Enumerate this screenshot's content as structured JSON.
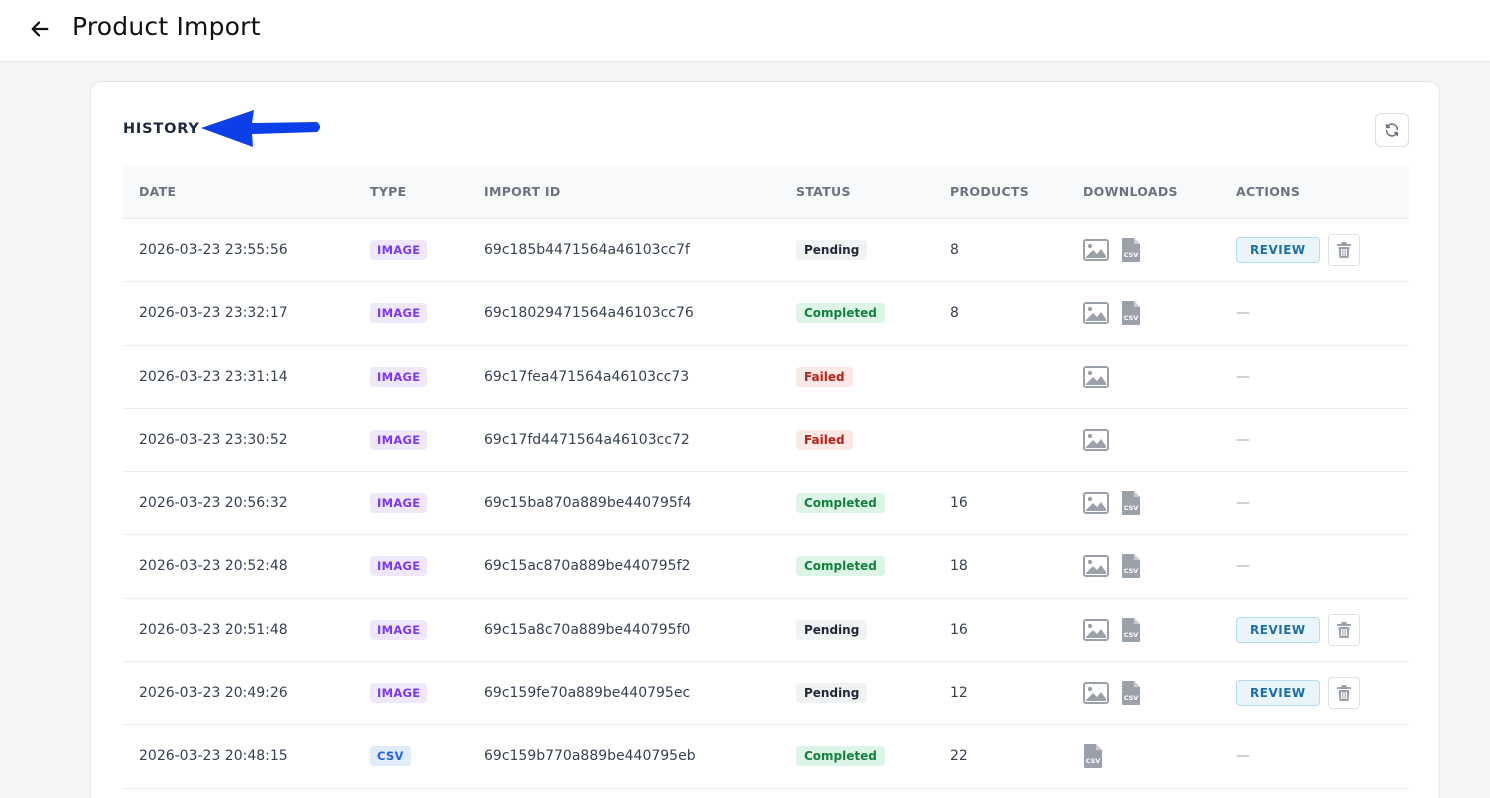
{
  "header": {
    "title": "Product Import"
  },
  "history": {
    "title": "HISTORY"
  },
  "table": {
    "columns": [
      "DATE",
      "TYPE",
      "IMPORT ID",
      "STATUS",
      "PRODUCTS",
      "DOWNLOADS",
      "ACTIONS"
    ],
    "rows": [
      {
        "date": "2026-03-23 23:55:56",
        "type": "IMAGE",
        "import_id": "69c185b4471564a46103cc7f",
        "status": "Pending",
        "products": "8",
        "downloads": [
          "image",
          "csv"
        ],
        "actions": "review"
      },
      {
        "date": "2026-03-23 23:32:17",
        "type": "IMAGE",
        "import_id": "69c18029471564a46103cc76",
        "status": "Completed",
        "products": "8",
        "downloads": [
          "image",
          "csv"
        ],
        "actions": "—"
      },
      {
        "date": "2026-03-23 23:31:14",
        "type": "IMAGE",
        "import_id": "69c17fea471564a46103cc73",
        "status": "Failed",
        "products": "",
        "downloads": [
          "image"
        ],
        "actions": "—"
      },
      {
        "date": "2026-03-23 23:30:52",
        "type": "IMAGE",
        "import_id": "69c17fd4471564a46103cc72",
        "status": "Failed",
        "products": "",
        "downloads": [
          "image"
        ],
        "actions": "—"
      },
      {
        "date": "2026-03-23 20:56:32",
        "type": "IMAGE",
        "import_id": "69c15ba870a889be440795f4",
        "status": "Completed",
        "products": "16",
        "downloads": [
          "image",
          "csv"
        ],
        "actions": "—"
      },
      {
        "date": "2026-03-23 20:52:48",
        "type": "IMAGE",
        "import_id": "69c15ac870a889be440795f2",
        "status": "Completed",
        "products": "18",
        "downloads": [
          "image",
          "csv"
        ],
        "actions": "—"
      },
      {
        "date": "2026-03-23 20:51:48",
        "type": "IMAGE",
        "import_id": "69c15a8c70a889be440795f0",
        "status": "Pending",
        "products": "16",
        "downloads": [
          "image",
          "csv"
        ],
        "actions": "review"
      },
      {
        "date": "2026-03-23 20:49:26",
        "type": "IMAGE",
        "import_id": "69c159fe70a889be440795ec",
        "status": "Pending",
        "products": "12",
        "downloads": [
          "image",
          "csv"
        ],
        "actions": "review"
      },
      {
        "date": "2026-03-23 20:48:15",
        "type": "CSV",
        "import_id": "69c159b770a889be440795eb",
        "status": "Completed",
        "products": "22",
        "downloads": [
          "csv"
        ],
        "actions": "—"
      }
    ]
  },
  "labels": {
    "review": "REVIEW",
    "csv_glyph": "CSV"
  },
  "icons": {
    "back": "arrow-left-icon",
    "refresh": "refresh-icon",
    "image_download": "image-icon",
    "csv_download": "csv-file-icon",
    "delete": "trash-icon",
    "annotation": "arrow-annotation-icon"
  },
  "colors": {
    "annotation_arrow": "#0b3fe8",
    "pending": "#1f2937",
    "completed": "#15803d",
    "failed": "#b42318",
    "image_badge": "#7c3aed",
    "csv_badge": "#2563eb",
    "review": "#1d6fa5"
  }
}
